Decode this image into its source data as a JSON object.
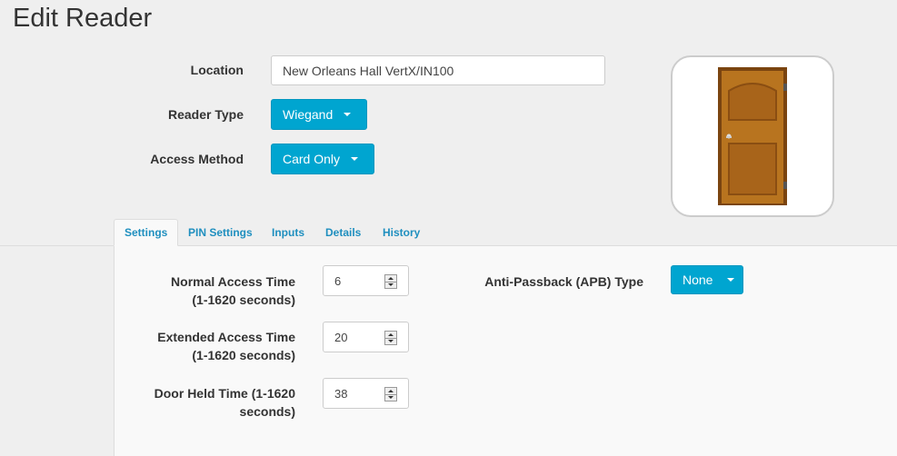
{
  "page": {
    "title": "Edit Reader"
  },
  "form": {
    "location": {
      "label": "Location",
      "value": "New Orleans Hall VertX/IN100"
    },
    "reader_type": {
      "label": "Reader Type",
      "value": "Wiegand"
    },
    "access_method": {
      "label": "Access Method",
      "value": "Card Only"
    }
  },
  "image": {
    "icon": "door-icon"
  },
  "tabs": [
    {
      "label": "Settings",
      "active": true
    },
    {
      "label": "PIN Settings",
      "active": false
    },
    {
      "label": "Inputs",
      "active": false
    },
    {
      "label": "Details",
      "active": false
    },
    {
      "label": "History",
      "active": false
    }
  ],
  "settings": {
    "normal_access": {
      "label_line1": "Normal Access Time",
      "label_line2": "(1-1620 seconds)",
      "value": "6"
    },
    "extended_access": {
      "label_line1": "Extended Access Time",
      "label_line2": "(1-1620 seconds)",
      "value": "20"
    },
    "door_held": {
      "label_line1": "Door Held Time (1-1620",
      "label_line2": "seconds)",
      "value": "38"
    },
    "apb": {
      "label": "Anti-Passback (APB) Type",
      "value": "None"
    }
  },
  "colors": {
    "accent": "#00a5d0",
    "tab_link": "#1f8fbf"
  }
}
